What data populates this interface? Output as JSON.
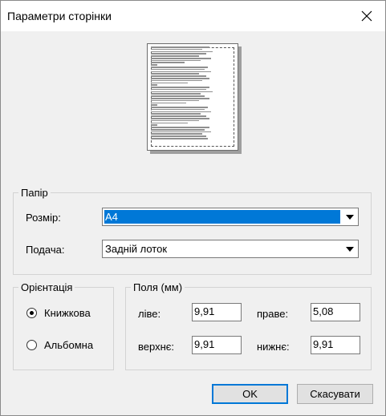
{
  "window": {
    "title": "Параметри сторінки",
    "close_icon": "close-icon"
  },
  "paper": {
    "group_label": "Папір",
    "size_label": "Розмір:",
    "size_value": "A4",
    "source_label": "Подача:",
    "source_value": "Задній лоток"
  },
  "orientation": {
    "group_label": "Орієнтація",
    "portrait_label": "Книжкова",
    "landscape_label": "Альбомна",
    "selected": "portrait"
  },
  "margins": {
    "group_label": "Поля (мм)",
    "left_label": "ліве:",
    "left_value": "9,91",
    "right_label": "праве:",
    "right_value": "5,08",
    "top_label": "верхнє:",
    "top_value": "9,91",
    "bottom_label": "нижнє:",
    "bottom_value": "9,91"
  },
  "buttons": {
    "ok": "OK",
    "cancel": "Скасувати"
  },
  "colors": {
    "selection": "#0078d7",
    "dialog_bg": "#f0f0f0"
  }
}
